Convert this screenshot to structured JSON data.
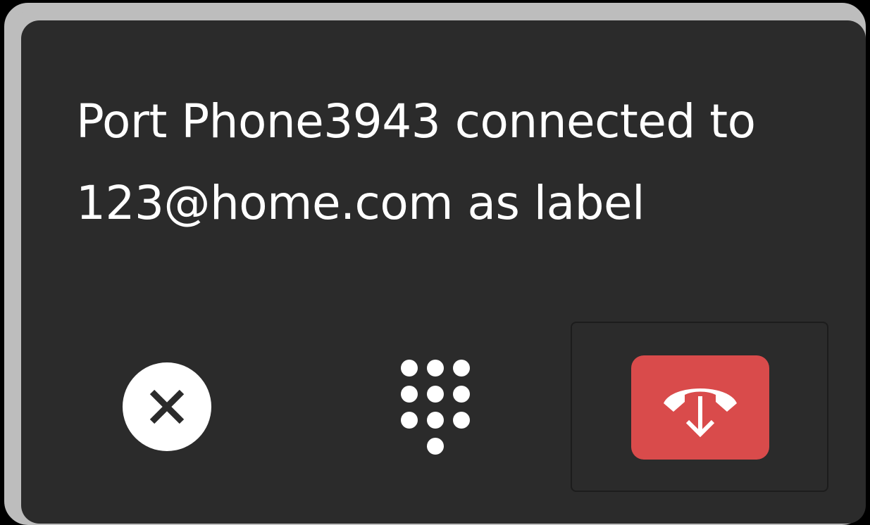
{
  "notification": {
    "message_line1": "Port Phone3943 connected to",
    "message_line2": "123@home.com as label"
  },
  "actions": {
    "dismiss_icon": "close-circle-icon",
    "dialpad_icon": "dialpad-icon",
    "hangup_icon": "phone-hangup-icon"
  },
  "colors": {
    "panel_background": "#2b2b2b",
    "frame_border": "#bdbdbd",
    "text": "#ffffff",
    "hangup_button": "#d94b4b"
  }
}
